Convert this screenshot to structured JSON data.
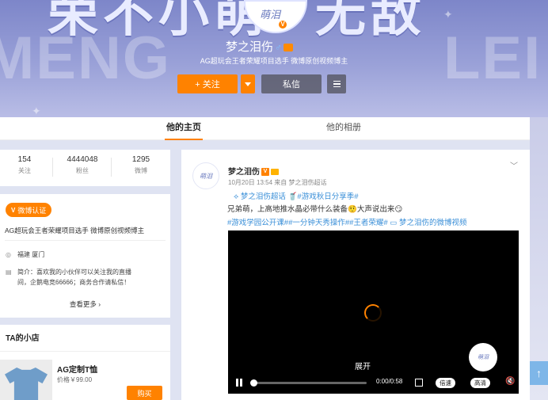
{
  "banner": {
    "big_title_left": "荣不小萌",
    "big_title_right": "无敌",
    "bg_word_left": "MENG",
    "bg_word_right": "LEI",
    "avatar_text": "萌泪",
    "verified_mark": "V",
    "name": "梦之泪伤",
    "gender_icon": "♂",
    "intro": "AG超玩会王者荣耀项目选手 微博原创视频博主",
    "follow_label": "+ 关注",
    "message_label": "私信"
  },
  "tabs": [
    {
      "label": "他的主页",
      "active": true
    },
    {
      "label": "他的相册",
      "active": false
    }
  ],
  "stats": [
    {
      "value": "154",
      "label": "关注"
    },
    {
      "value": "4444048",
      "label": "粉丝"
    },
    {
      "value": "1295",
      "label": "微博"
    }
  ],
  "about": {
    "verify_badge": "微博认证",
    "verify_text": "AG超玩会王者荣耀项目选手 微博原创视频博主",
    "location": "福建 厦门",
    "bio": "简介：喜欢我的小伙伴可以关注我的直播间，企鹅电竞66666；商务合作请私信！",
    "bio_line1": "简介：喜欢我的小伙伴可以关注我的直播",
    "bio_line2": "间，企鹅电竞66666；商务合作请私信！",
    "more": "查看更多 ›"
  },
  "shop": {
    "title": "TA的小店",
    "product": "AG定制T恤",
    "price": "价格￥99.00",
    "buy": "购买"
  },
  "post": {
    "avatar_text": "萌泪",
    "author": "梦之泪伤",
    "meta": "10月20日 13:54 来自 梦之泪伤超话",
    "supertopic": "梦之泪伤超话",
    "topic": "#游戏秋日分享季#",
    "text": "兄弟萌，上高地推水晶必带什么装备🤨大声说出来😏",
    "tags": "#游戏学园公开课##一分钟天秀操作##王者荣耀#  ▭ 梦之泪伤的微博视频"
  },
  "video": {
    "unfold": "展开",
    "avatar_text": "萌泪",
    "time": "0:00/0:58",
    "speed": "倍速",
    "quality": "高清",
    "progress": 0
  },
  "colors": {
    "accent": "#ff8200",
    "link": "#3a8fd8"
  }
}
